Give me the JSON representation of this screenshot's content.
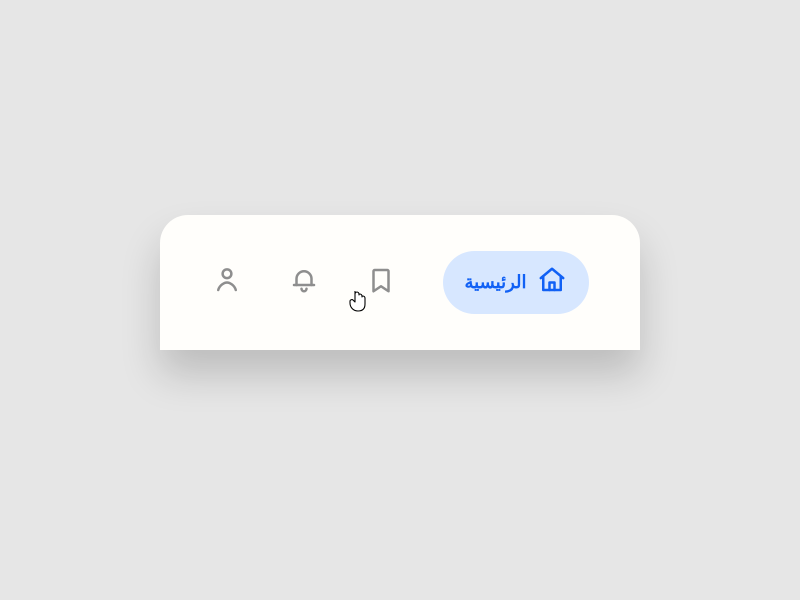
{
  "nav": {
    "home": {
      "label": "الرئيسية",
      "icon": "home-icon",
      "active": true
    },
    "bookmark": {
      "icon": "bookmark-icon"
    },
    "bell": {
      "icon": "bell-icon"
    },
    "user": {
      "icon": "user-icon"
    }
  },
  "colors": {
    "accent": "#1161f5",
    "accent_bg": "#d7e7ff",
    "icon_inactive": "#8e8e8e",
    "card_bg": "#fffefb",
    "page_bg": "#e6e6e6"
  }
}
